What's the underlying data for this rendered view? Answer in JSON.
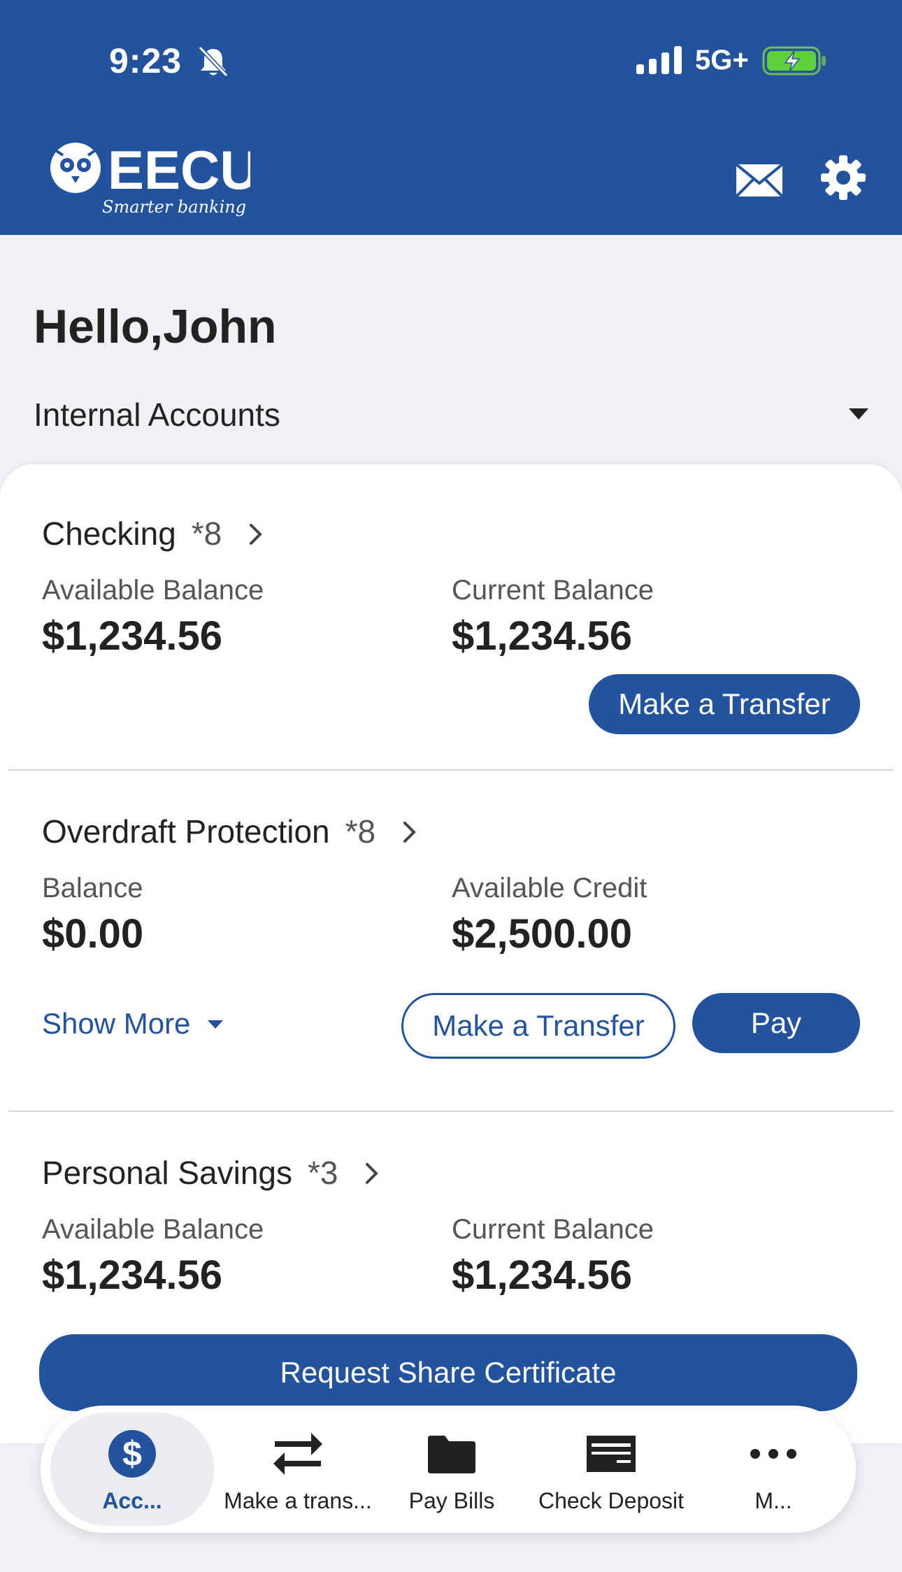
{
  "status_bar": {
    "time": "9:23",
    "network": "5G+"
  },
  "header": {
    "logo_text": "EECU",
    "logo_tagline": "Smarter banking"
  },
  "greeting": "Hello,John",
  "accounts_filter": "Internal Accounts",
  "accounts": [
    {
      "name": "Checking",
      "number": "*8",
      "left_label": "Available Balance",
      "left_value": "$1,234.56",
      "right_label": "Current Balance",
      "right_value": "$1,234.56",
      "transfer_label": "Make a Transfer"
    },
    {
      "name": "Overdraft Protection",
      "number": "*8",
      "left_label": "Balance",
      "left_value": "$0.00",
      "right_label": "Available Credit",
      "right_value": "$2,500.00",
      "show_more_label": "Show More",
      "transfer_label": "Make a Transfer",
      "pay_label": "Pay"
    },
    {
      "name": "Personal Savings",
      "number": "*3",
      "left_label": "Available Balance",
      "left_value": "$1,234.56",
      "right_label": "Current Balance",
      "right_value": "$1,234.56",
      "certificate_label": "Request Share Certificate"
    }
  ],
  "tabs": [
    {
      "label": "Acc...",
      "icon": "dollar-circle-icon",
      "active": true
    },
    {
      "label": "Make a trans...",
      "icon": "transfer-arrows-icon"
    },
    {
      "label": "Pay Bills",
      "icon": "folder-icon"
    },
    {
      "label": "Check Deposit",
      "icon": "check-icon"
    },
    {
      "label": "M...",
      "icon": "more-dots-icon"
    }
  ],
  "colors": {
    "brand_blue": "#23539e",
    "background": "#f0f1f4",
    "card": "#ffffff"
  }
}
